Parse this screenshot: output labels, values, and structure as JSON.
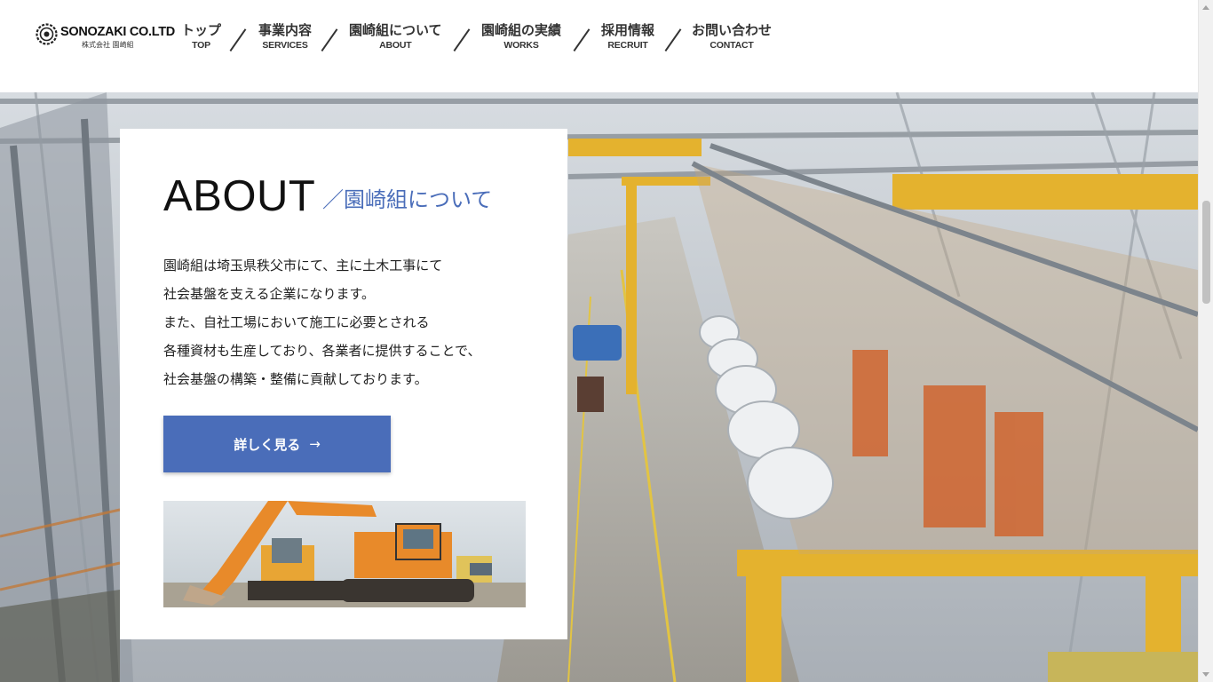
{
  "header": {
    "logo": {
      "name": "SONOZAKI CO.LTD",
      "sub": "株式会社 園崎組"
    },
    "nav": [
      {
        "jp": "トップ",
        "en": "TOP"
      },
      {
        "jp": "事業内容",
        "en": "SERVICES"
      },
      {
        "jp": "園崎組について",
        "en": "ABOUT"
      },
      {
        "jp": "園崎組の実績",
        "en": "WORKS"
      },
      {
        "jp": "採用情報",
        "en": "RECRUIT"
      },
      {
        "jp": "お問い合わせ",
        "en": "CONTACT"
      }
    ]
  },
  "about": {
    "title": "ABOUT",
    "subtitle": "／園崎組について",
    "paragraph": [
      "園崎組は埼玉県秩父市にて、主に土木工事にて",
      "社会基盤を支える企業になります。",
      "また、自社工場において施工に必要とされる",
      "各種資材も生産しており、各業者に提供することで、",
      "社会基盤の構築・整備に貢献しております。"
    ],
    "button": {
      "label": "詳しく見る",
      "icon": "arrow-right-icon",
      "arrow": "→"
    }
  },
  "colors": {
    "accent": "#4a6db9",
    "excavator": "#e88a2a",
    "crane": "#e4b22e"
  },
  "hero_image": "factory-interior",
  "photo_image": "excavators-on-site"
}
